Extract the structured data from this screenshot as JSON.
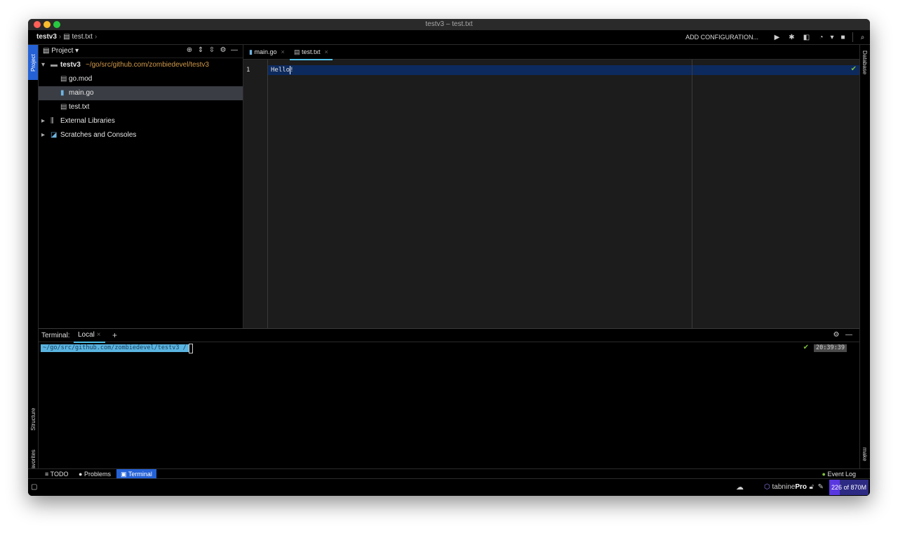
{
  "window": {
    "title": "testv3 – test.txt"
  },
  "navbar": {
    "project": "testv3",
    "file": "test.txt",
    "add_configuration": "ADD CONFIGURATION..."
  },
  "left_strip": {
    "project_tab": "Project",
    "structure_tab": "Structure",
    "favorites_tab": "Favorites"
  },
  "right_strip": {
    "database_tab": "Database",
    "make_tab": "make"
  },
  "project_panel": {
    "title": "Project",
    "tree": [
      {
        "name": "testv3",
        "path": "~/go/src/github.com/zombiedevel/testv3",
        "icon": "folder-icon"
      },
      {
        "name": "go.mod",
        "icon": "file-icon"
      },
      {
        "name": "main.go",
        "icon": "go-file-icon",
        "selected": true
      },
      {
        "name": "test.txt",
        "icon": "text-file-icon"
      },
      {
        "name": "External Libraries",
        "icon": "library-icon"
      },
      {
        "name": "Scratches and Consoles",
        "icon": "scratches-icon"
      }
    ]
  },
  "editor": {
    "tabs": [
      {
        "label": "main.go"
      },
      {
        "label": "test.txt",
        "active": true
      }
    ],
    "line_number": "1",
    "line_text": "Hello!"
  },
  "terminal": {
    "label": "Terminal:",
    "tab": "Local",
    "prompt": "~/go/src/github.com/zombiedevel/testv3 /",
    "time": "20:39:39"
  },
  "toolwindows": {
    "todo": "TODO",
    "problems": "Problems",
    "terminal": "Terminal",
    "event_log": "Event Log"
  },
  "status": {
    "tabnine": "tabnine",
    "tabnine_pro": "Pro",
    "memory_used": "226",
    "memory_sep": " of ",
    "memory_total": "870M",
    "memory_fraction": 0.26
  },
  "colors": {
    "accent": "#4fc1e9",
    "selection": "#2461d6",
    "path": "#d29a4a"
  }
}
